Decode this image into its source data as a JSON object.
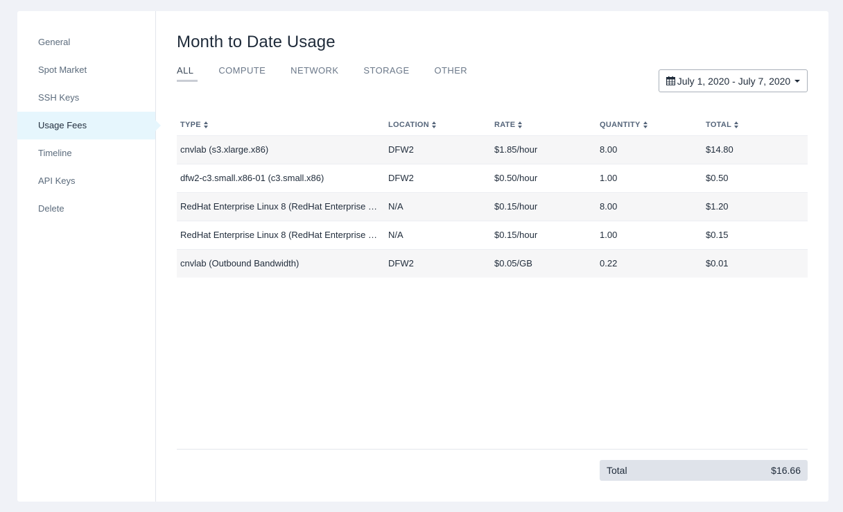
{
  "sidebar": {
    "items": [
      {
        "label": "General"
      },
      {
        "label": "Spot Market"
      },
      {
        "label": "SSH Keys"
      },
      {
        "label": "Usage Fees"
      },
      {
        "label": "Timeline"
      },
      {
        "label": "API Keys"
      },
      {
        "label": "Delete"
      }
    ],
    "active": "Usage Fees"
  },
  "main": {
    "title": "Month to Date Usage",
    "tabs": [
      {
        "label": "ALL"
      },
      {
        "label": "COMPUTE"
      },
      {
        "label": "NETWORK"
      },
      {
        "label": "STORAGE"
      },
      {
        "label": "OTHER"
      }
    ],
    "active_tab": "ALL",
    "date_range": "July 1, 2020 - July 7, 2020",
    "table": {
      "headers": [
        "TYPE",
        "LOCATION",
        "RATE",
        "QUANTITY",
        "TOTAL"
      ],
      "rows": [
        [
          "cnvlab (s3.xlarge.x86)",
          "DFW2",
          "$1.85/hour",
          "8.00",
          "$14.80"
        ],
        [
          "dfw2-c3.small.x86-01 (c3.small.x86)",
          "DFW2",
          "$0.50/hour",
          "1.00",
          "$0.50"
        ],
        [
          "RedHat Enterprise Linux 8 (RedHat Enterprise …",
          "N/A",
          "$0.15/hour",
          "8.00",
          "$1.20"
        ],
        [
          "RedHat Enterprise Linux 8 (RedHat Enterprise …",
          "N/A",
          "$0.15/hour",
          "1.00",
          "$0.15"
        ],
        [
          "cnvlab (Outbound Bandwidth)",
          "DFW2",
          "$0.05/GB",
          "0.22",
          "$0.01"
        ]
      ]
    },
    "total": {
      "label": "Total",
      "value": "$16.66"
    }
  },
  "colors": {
    "page_bg": "#f0f2f7",
    "active_sidebar_bg": "#e6f6fd",
    "total_bg": "#dfe3ea"
  }
}
